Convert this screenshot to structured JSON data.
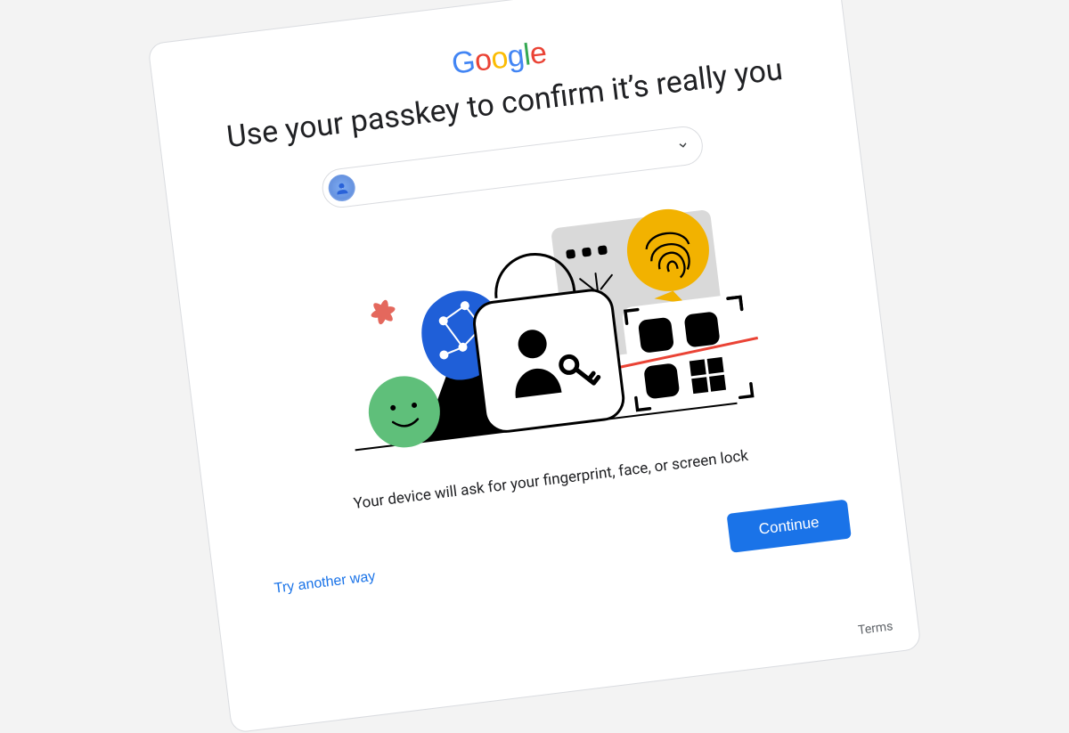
{
  "brand": {
    "g": "G",
    "o1": "o",
    "o2": "o",
    "g2": "g",
    "l": "l",
    "e": "e",
    "colors": {
      "g": "#4285F4",
      "o1": "#EA4335",
      "o2": "#FBBC04",
      "g2": "#4285F4",
      "l": "#34A853",
      "e": "#EA4335"
    }
  },
  "heading": "Use your passkey to confirm it’s really you",
  "account": {
    "label": ""
  },
  "description": "Your device will ask for your fingerprint, face, or screen lock",
  "actions": {
    "try_another": "Try another way",
    "continue": "Continue"
  },
  "footer": {
    "terms": "Terms"
  }
}
